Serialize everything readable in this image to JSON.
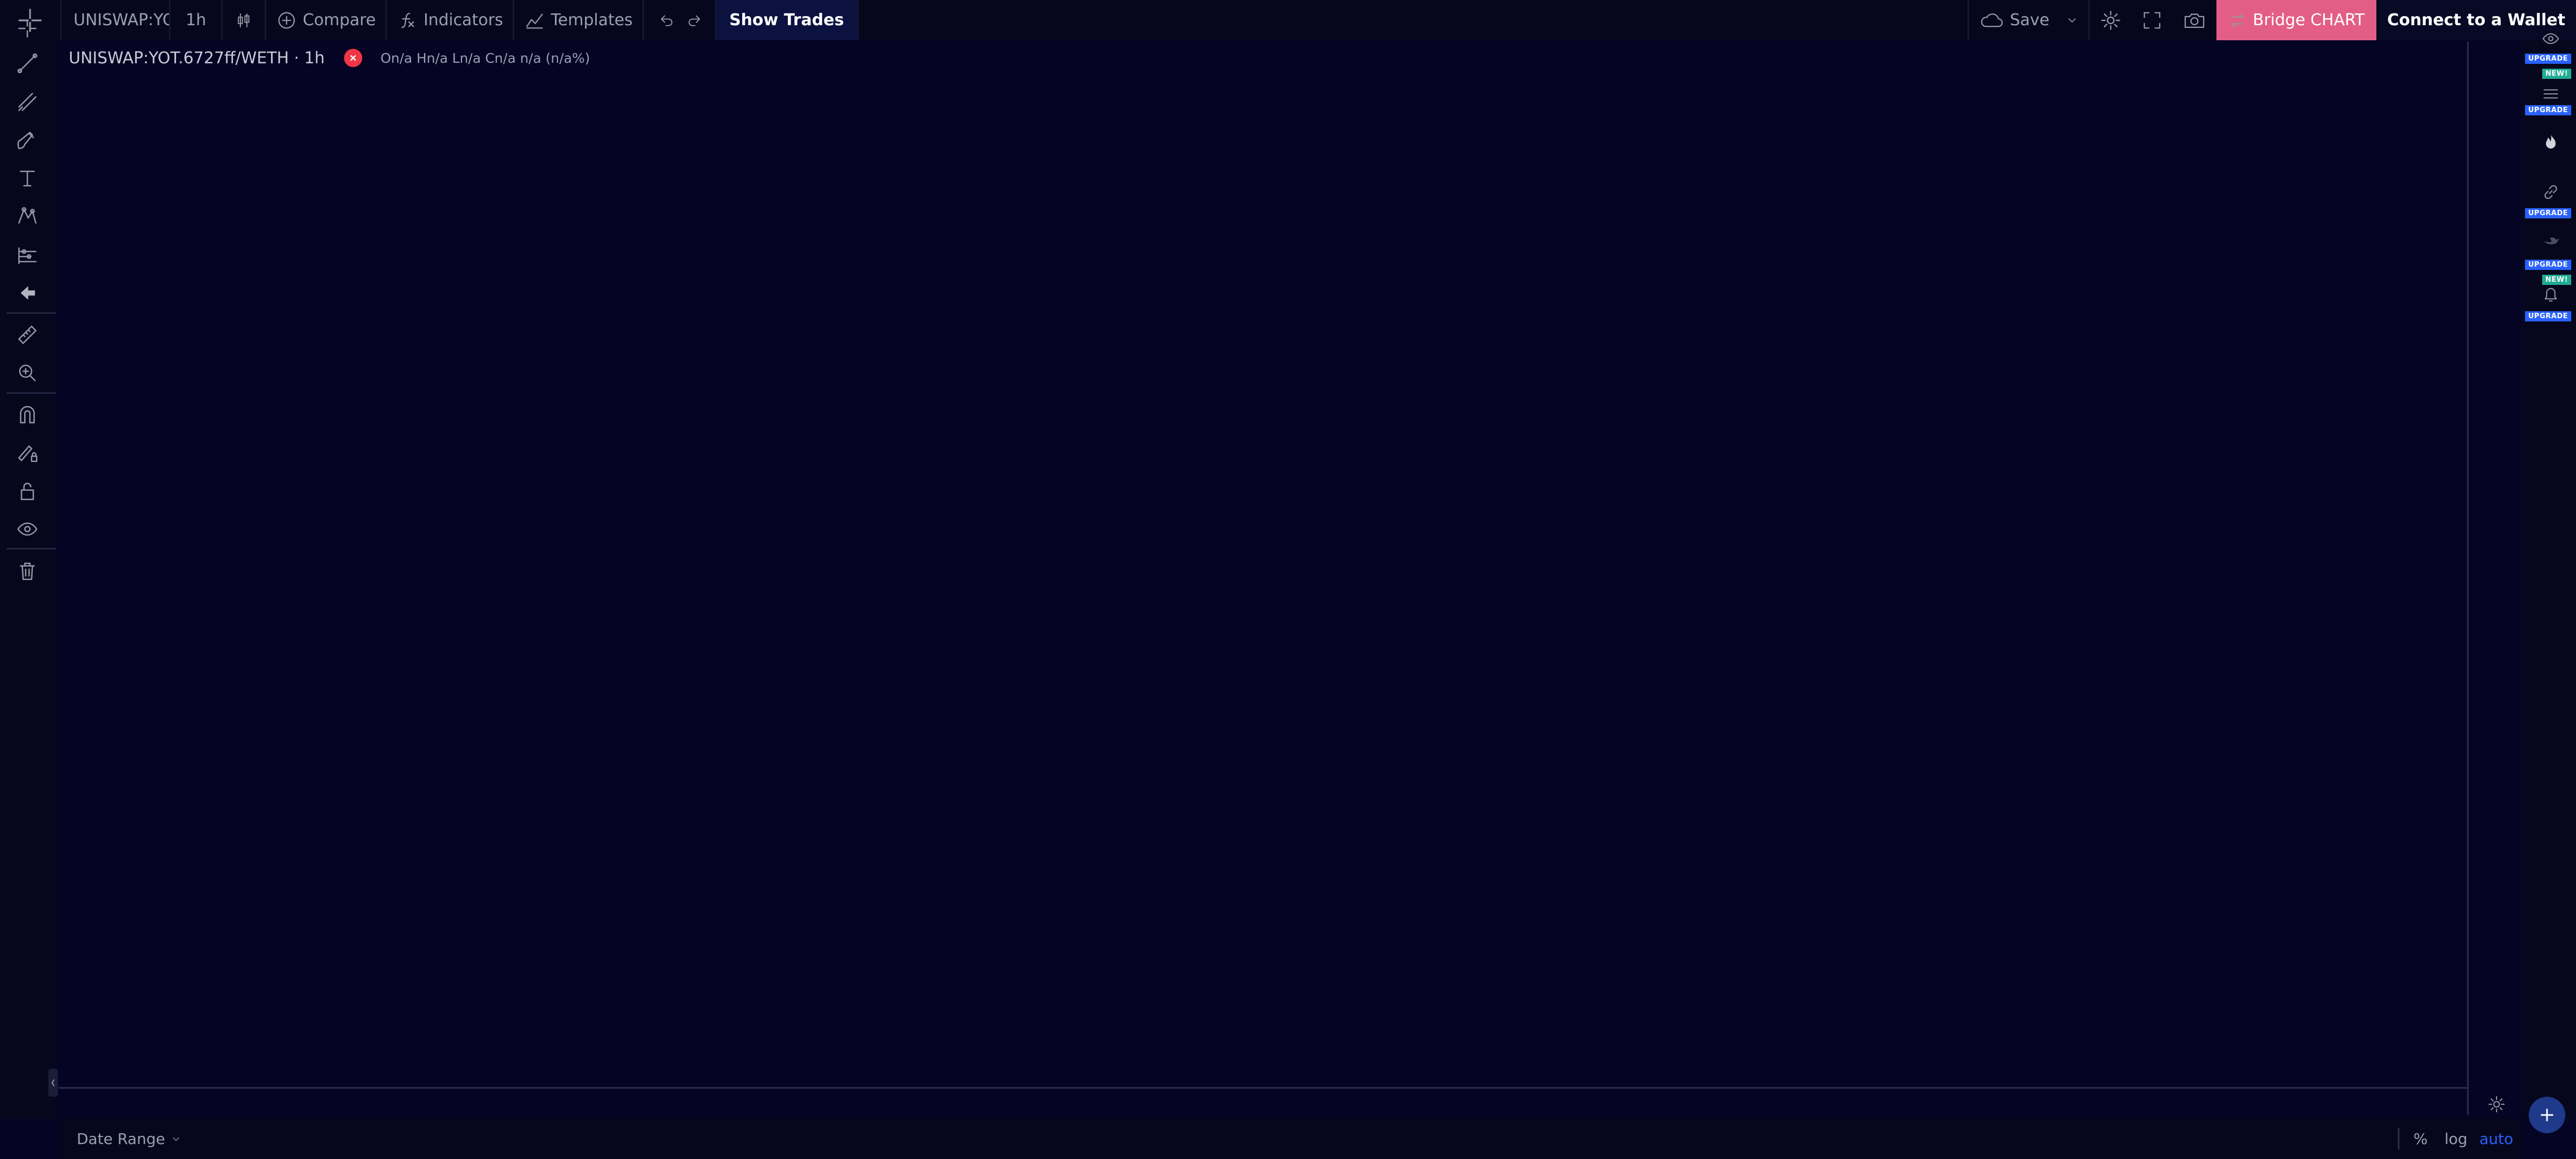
{
  "toolbar": {
    "symbol": "UNISWAP:YOT.6727ff/WETH",
    "interval": "1h",
    "compare_label": "Compare",
    "indicators_label": "Indicators",
    "templates_label": "Templates",
    "show_trades_label": "Show Trades",
    "save_label": "Save",
    "bridge_label": "Bridge CHART",
    "wallet_label": "Connect to a Wallet"
  },
  "legend": {
    "symbol_line": "UNISWAP:YOT.6727ff/WETH · 1h",
    "ohlc": "On/a Hn/a Ln/a Cn/a n/a (n/a%)"
  },
  "right_strip": {
    "upgrade_label": "UPGRADE",
    "new_label": "NEW!"
  },
  "bottom": {
    "date_range_label": "Date Range",
    "percent_label": "%",
    "log_label": "log",
    "auto_label": "auto"
  },
  "colors": {
    "background": "#050425",
    "bridge_button": "#e35e86",
    "accent_blue": "#2962ff",
    "new_badge": "#22ab94",
    "close_red": "#f23645"
  },
  "left_tools": [
    "crosshair-icon",
    "trend-line-icon",
    "fib-tool-icon",
    "brush-icon",
    "text-icon",
    "pattern-icon",
    "prediction-icon",
    "arrow-back-icon",
    "ruler-icon",
    "zoom-in-icon",
    "magnet-icon",
    "lock-drawing-icon",
    "lock-icon",
    "eye-icon",
    "trash-icon"
  ]
}
